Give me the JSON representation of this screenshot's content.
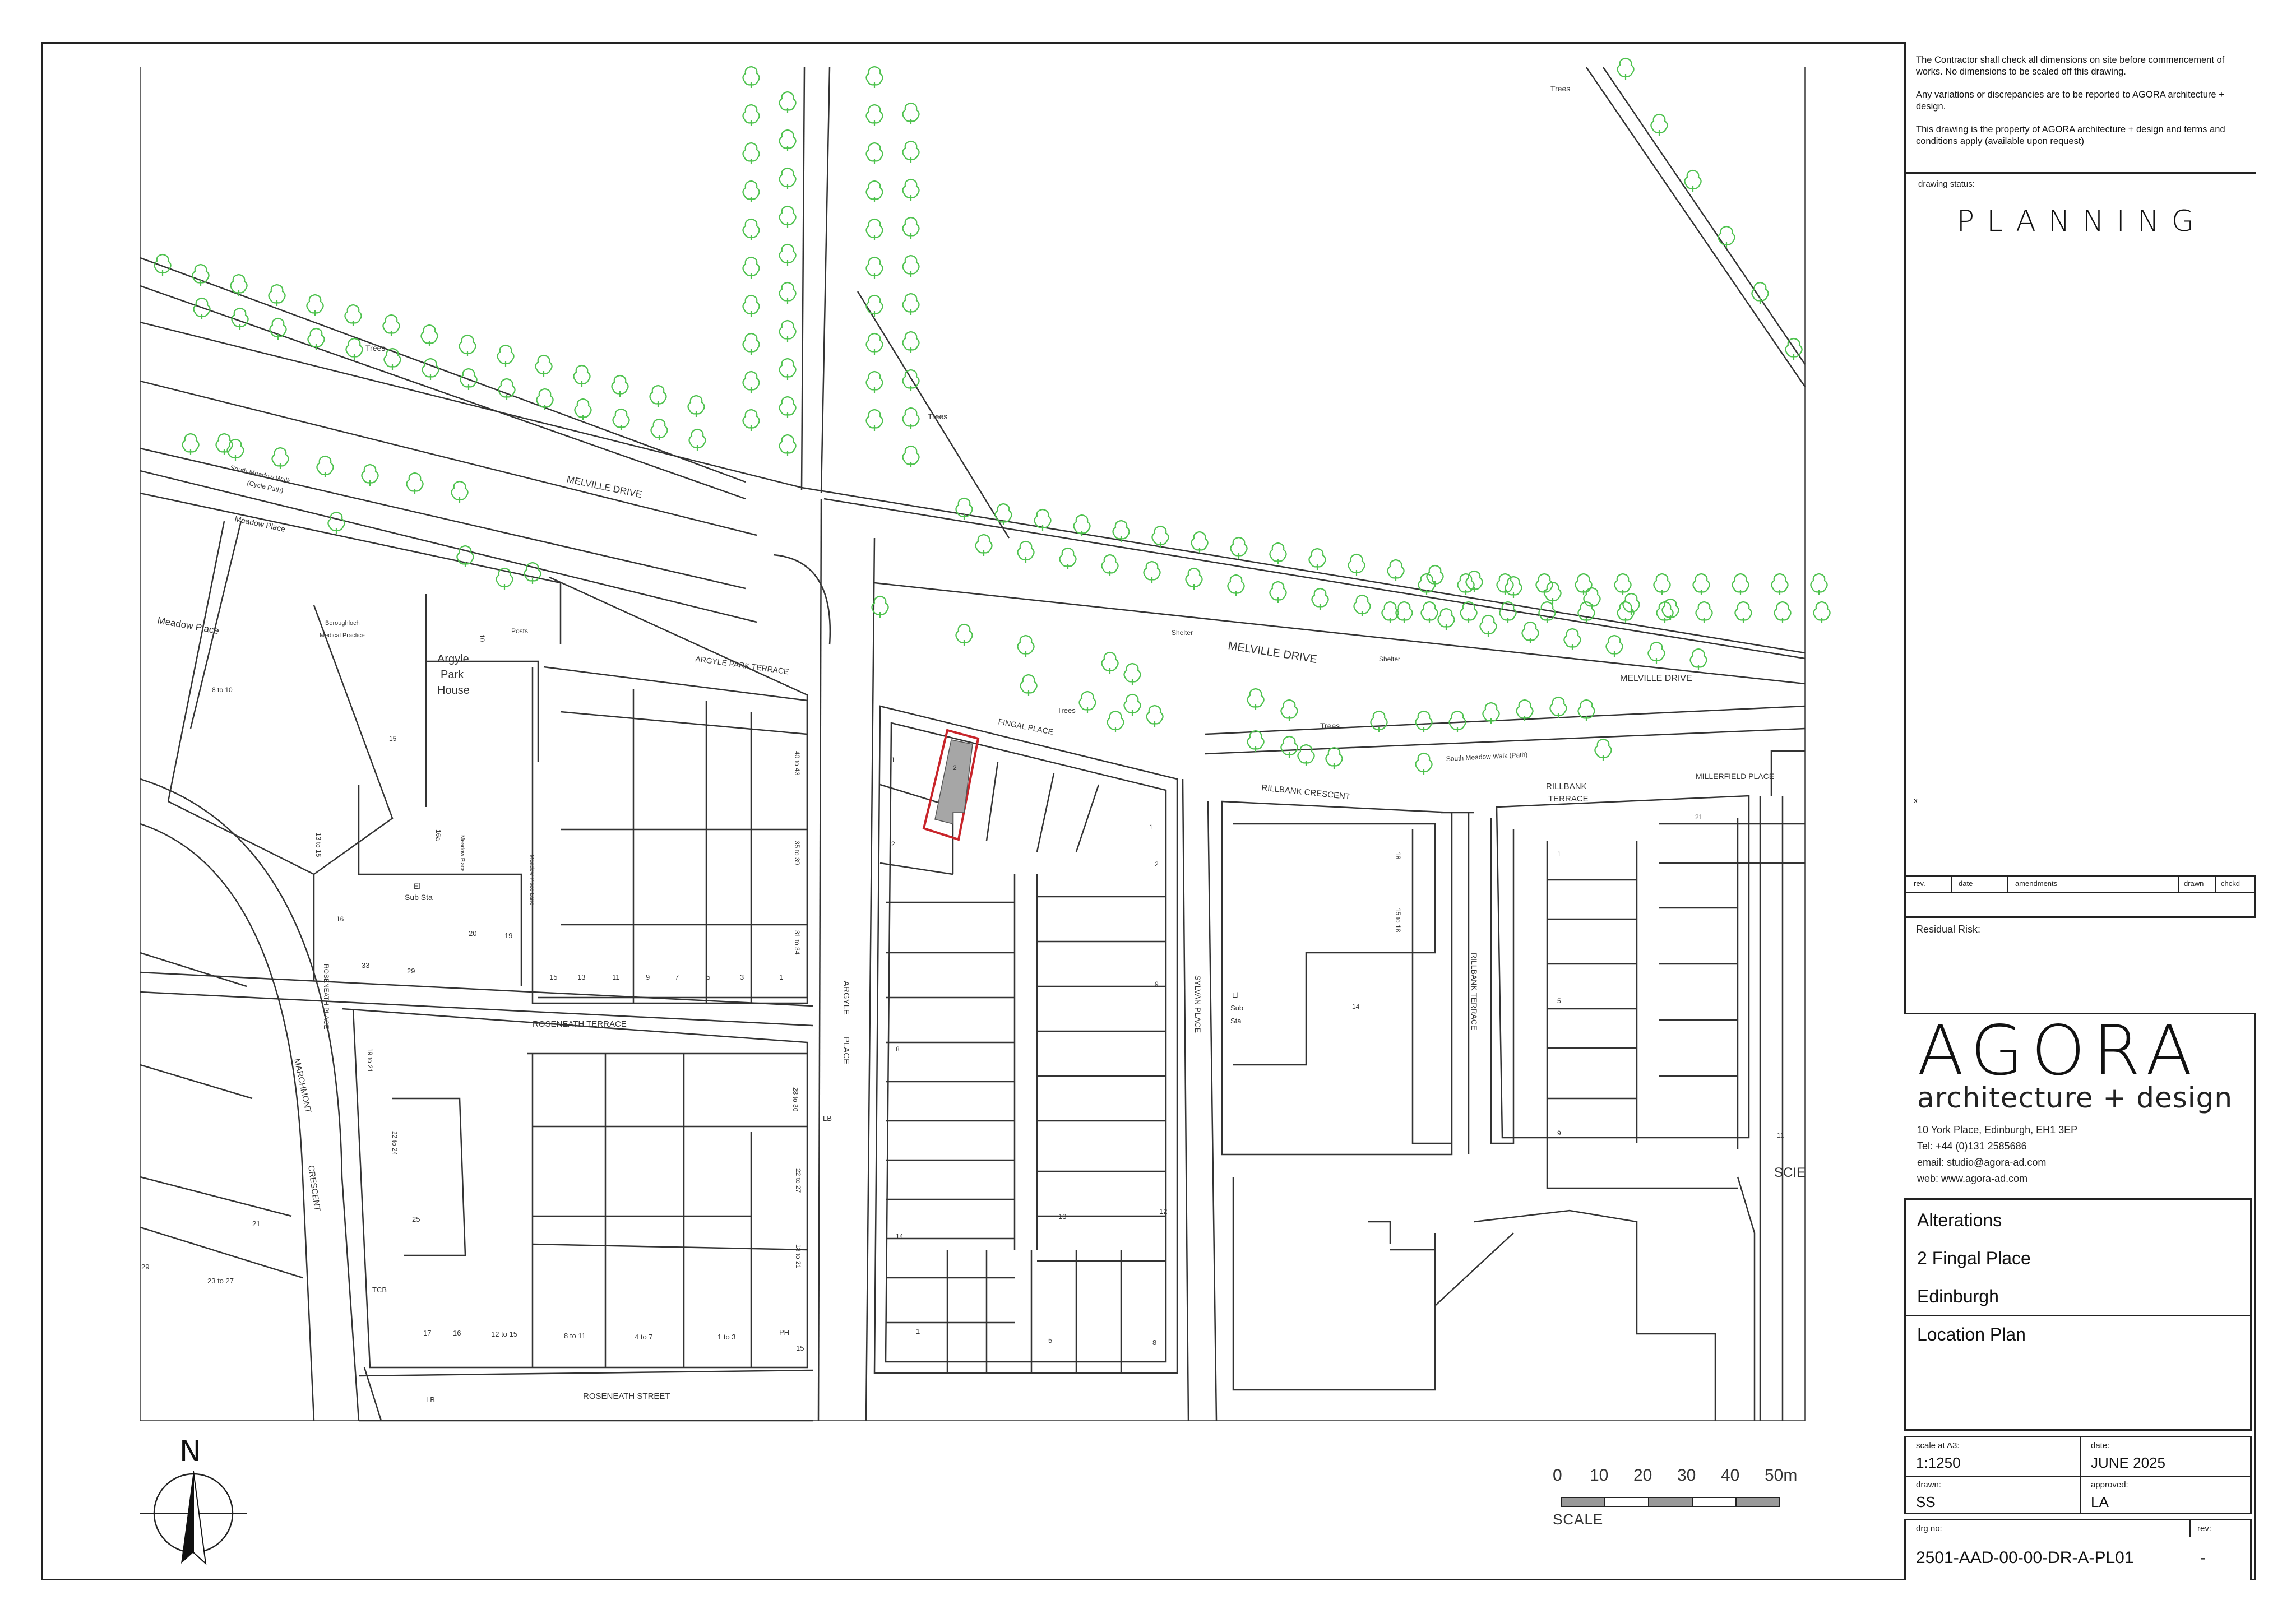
{
  "notes": [
    "The Contractor shall check all dimensions on site before commencement of works. No dimensions to be scaled off this drawing.",
    "Any variations or discrepancies are to be reported to AGORA architecture + design.",
    "This drawing is the property of AGORA architecture + design and terms and conditions apply (available upon request)"
  ],
  "status": {
    "label": "drawing status:",
    "value": "PLANNING",
    "x_mark": "x"
  },
  "amendments": {
    "rev": "rev.",
    "date": "date",
    "amendments": "amendments",
    "drawn": "drawn",
    "chckd": "chckd"
  },
  "residual_risk": {
    "label": "Residual Risk:"
  },
  "logo": {
    "name": "AGORA",
    "tagline": "architecture + design"
  },
  "address": {
    "line1": "10 York Place, Edinburgh, EH1 3EP",
    "tel": "Tel: +44  (0)131 2585686",
    "email": "email: studio@agora-ad.com",
    "web": "web: www.agora-ad.com"
  },
  "title": {
    "line1": "Alterations",
    "line2": "2 Fingal Place",
    "line3": "Edinburgh",
    "drawing_title": "Location Plan"
  },
  "scale_block": {
    "scale_label": "scale at A3:",
    "scale_value": "1:1250",
    "date_label": "date:",
    "date_value": "JUNE 2025",
    "drawn_label": "drawn:",
    "drawn_value": "SS",
    "approved_label": "approved:",
    "approved_value": "LA"
  },
  "drawing_number": {
    "label": "drg no:",
    "value": "2501-AAD-00-00-DR-A-PL01",
    "rev_label": "rev:",
    "rev_value": "-"
  },
  "north": {
    "letter": "N"
  },
  "scalebar": {
    "ticks": [
      "0",
      "10",
      "20",
      "30",
      "40",
      "50m"
    ],
    "caption": "SCALE"
  },
  "map": {
    "colors": {
      "trees": "#4ec24e",
      "site_boundary": "#c8242a",
      "site_fill": "#a6a6a6",
      "lines": "#333333"
    },
    "streets": {
      "melville_drive_w": "MELVILLE DRIVE",
      "melville_drive_e": "MELVILLE DRIVE",
      "melville_drive_far": "MELVILLE   DRIVE",
      "south_meadow_walk": "South Meadow Walk",
      "cycle_path": "(Cycle Path)",
      "south_meadow_walk_path": "South Meadow Walk (Path)",
      "meadow_place": "Meadow Place",
      "meadow_place_2": "Meadow Place",
      "argyle_park_terrace": "ARGYLE PARK TERRACE",
      "fingal_place": "FINGAL PLACE",
      "rillbank_crescent": "RILLBANK CRESCENT",
      "rillbank_terrace_a": "RILLBANK",
      "rillbank_terrace_b": "TERRACE",
      "rillbank_terrace_v": "RILLBANK TERRACE",
      "millerfield_place": "MILLERFIELD PLACE",
      "roseneath_terrace": "ROSENEATH TERRACE",
      "roseneath_place": "ROSENEATH PLACE",
      "roseneath_street": "ROSENEATH STREET",
      "argyle_place_a": "ARGYLE",
      "argyle_place_b": "PLACE",
      "sylvan_place": "SYLVAN PLACE",
      "marchmont_a": "MARCHMONT",
      "marchmont_b": "CRESCENT",
      "meadow_place_lane": "Meadow Place Lane",
      "meadow_place_lane2": "Meadow Place",
      "scie": "SCIE"
    },
    "buildings": {
      "argyle_a": "Argyle",
      "argyle_b": "Park",
      "argyle_c": "House",
      "med_a": "Boroughloch",
      "med_b": "Medical Practice",
      "trees_1": "Trees",
      "trees_2": "Trees",
      "trees_3": "Trees",
      "trees_4": "Trees",
      "trees_5": "Trees",
      "shelter_1": "Shelter",
      "shelter_2": "Shelter",
      "posts": "Posts",
      "el_sub_1": "El",
      "el_sub_1b": "Sub Sta",
      "el_sub_2": "El",
      "el_sub_2b": "Sub",
      "el_sub_2c": "Sta",
      "lb_1": "LB",
      "lb_2": "LB",
      "tcb": "TCB",
      "ph": "PH"
    },
    "numbers": {
      "n_15a": "15",
      "n_13": "13",
      "n_11": "11",
      "n_9": "9",
      "n_7": "7",
      "n_5": "5",
      "n_3": "3",
      "n_1": "1",
      "n_33": "33",
      "n_29": "29",
      "n_20": "20",
      "n_19": "19",
      "n_31to34": "31 to 34",
      "n_35to39": "35 to 39",
      "n_40to43": "40 to 43",
      "n_17": "17",
      "n_16": "16",
      "n_12to15": "12 to 15",
      "n_8to11": "8 to 11",
      "n_4to7": "4 to 7",
      "n_1to3": "1 to 3",
      "n_15b": "15",
      "n_23to27": "23 to 27",
      "n_29b": "29",
      "n_21": "21",
      "n_25": "25",
      "n_22to24": "22 to 24",
      "n_19to21": "19 to 21",
      "n_18to21": "18 to 21",
      "n_22to27": "22 to 27",
      "n_28to30": "28 to 30",
      "n_fp1": "1",
      "n_fp2": "2",
      "n_row1": "1",
      "n_row2": "2",
      "n_row8": "8",
      "n_row14": "14",
      "n_s1": "1",
      "n_s5": "5",
      "n_s8": "8",
      "n_s12": "12",
      "n_s13": "13",
      "n_s9": "9",
      "n_r1": "1",
      "n_r5": "5",
      "n_r9": "9",
      "n_r14": "14",
      "n_r15to18": "15 to 18",
      "n_r18": "18",
      "n_m21": "21",
      "n_m11": "11",
      "n_10": "10",
      "n_8to10": "8 to 10",
      "n_13to15": "13 to 15",
      "n_16a": "16a",
      "n_15c": "15"
    }
  }
}
